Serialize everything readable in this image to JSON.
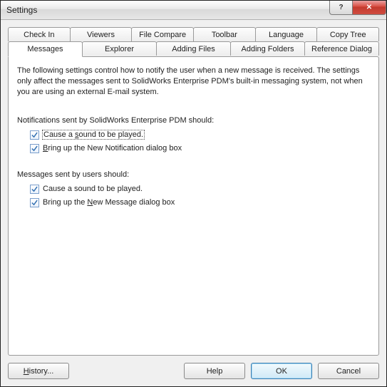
{
  "window": {
    "title": "Settings",
    "help_symbol": "?",
    "close_symbol": "✕"
  },
  "tabs": {
    "back": [
      "Check In",
      "Viewers",
      "File Compare",
      "Toolbar",
      "Language",
      "Copy Tree"
    ],
    "front": [
      "Messages",
      "Explorer",
      "Adding Files",
      "Adding Folders",
      "Reference Dialog"
    ],
    "active": "Messages"
  },
  "panel": {
    "description": "The following settings control how to notify the user when a new message is received. The settings only affect the messages sent to SolidWorks Enterprise PDM's built-in messaging system, not when you are using an external E-mail system.",
    "section1_label": "Notifications sent by SolidWorks Enterprise PDM should:",
    "check1": {
      "prefix": "Cause a ",
      "u": "s",
      "suffix": "ound to be played."
    },
    "check2": {
      "prefix": "",
      "u": "B",
      "suffix": "ring up the New Notification dialog box"
    },
    "section2_label": "Messages sent by users should:",
    "check3": {
      "prefix": "Cause a sound to be played."
    },
    "check4": {
      "prefix": "Bring up the ",
      "u": "N",
      "suffix": "ew Message dialog box"
    }
  },
  "footer": {
    "history": "History...",
    "help": "Help",
    "ok": "OK",
    "cancel": "Cancel"
  }
}
